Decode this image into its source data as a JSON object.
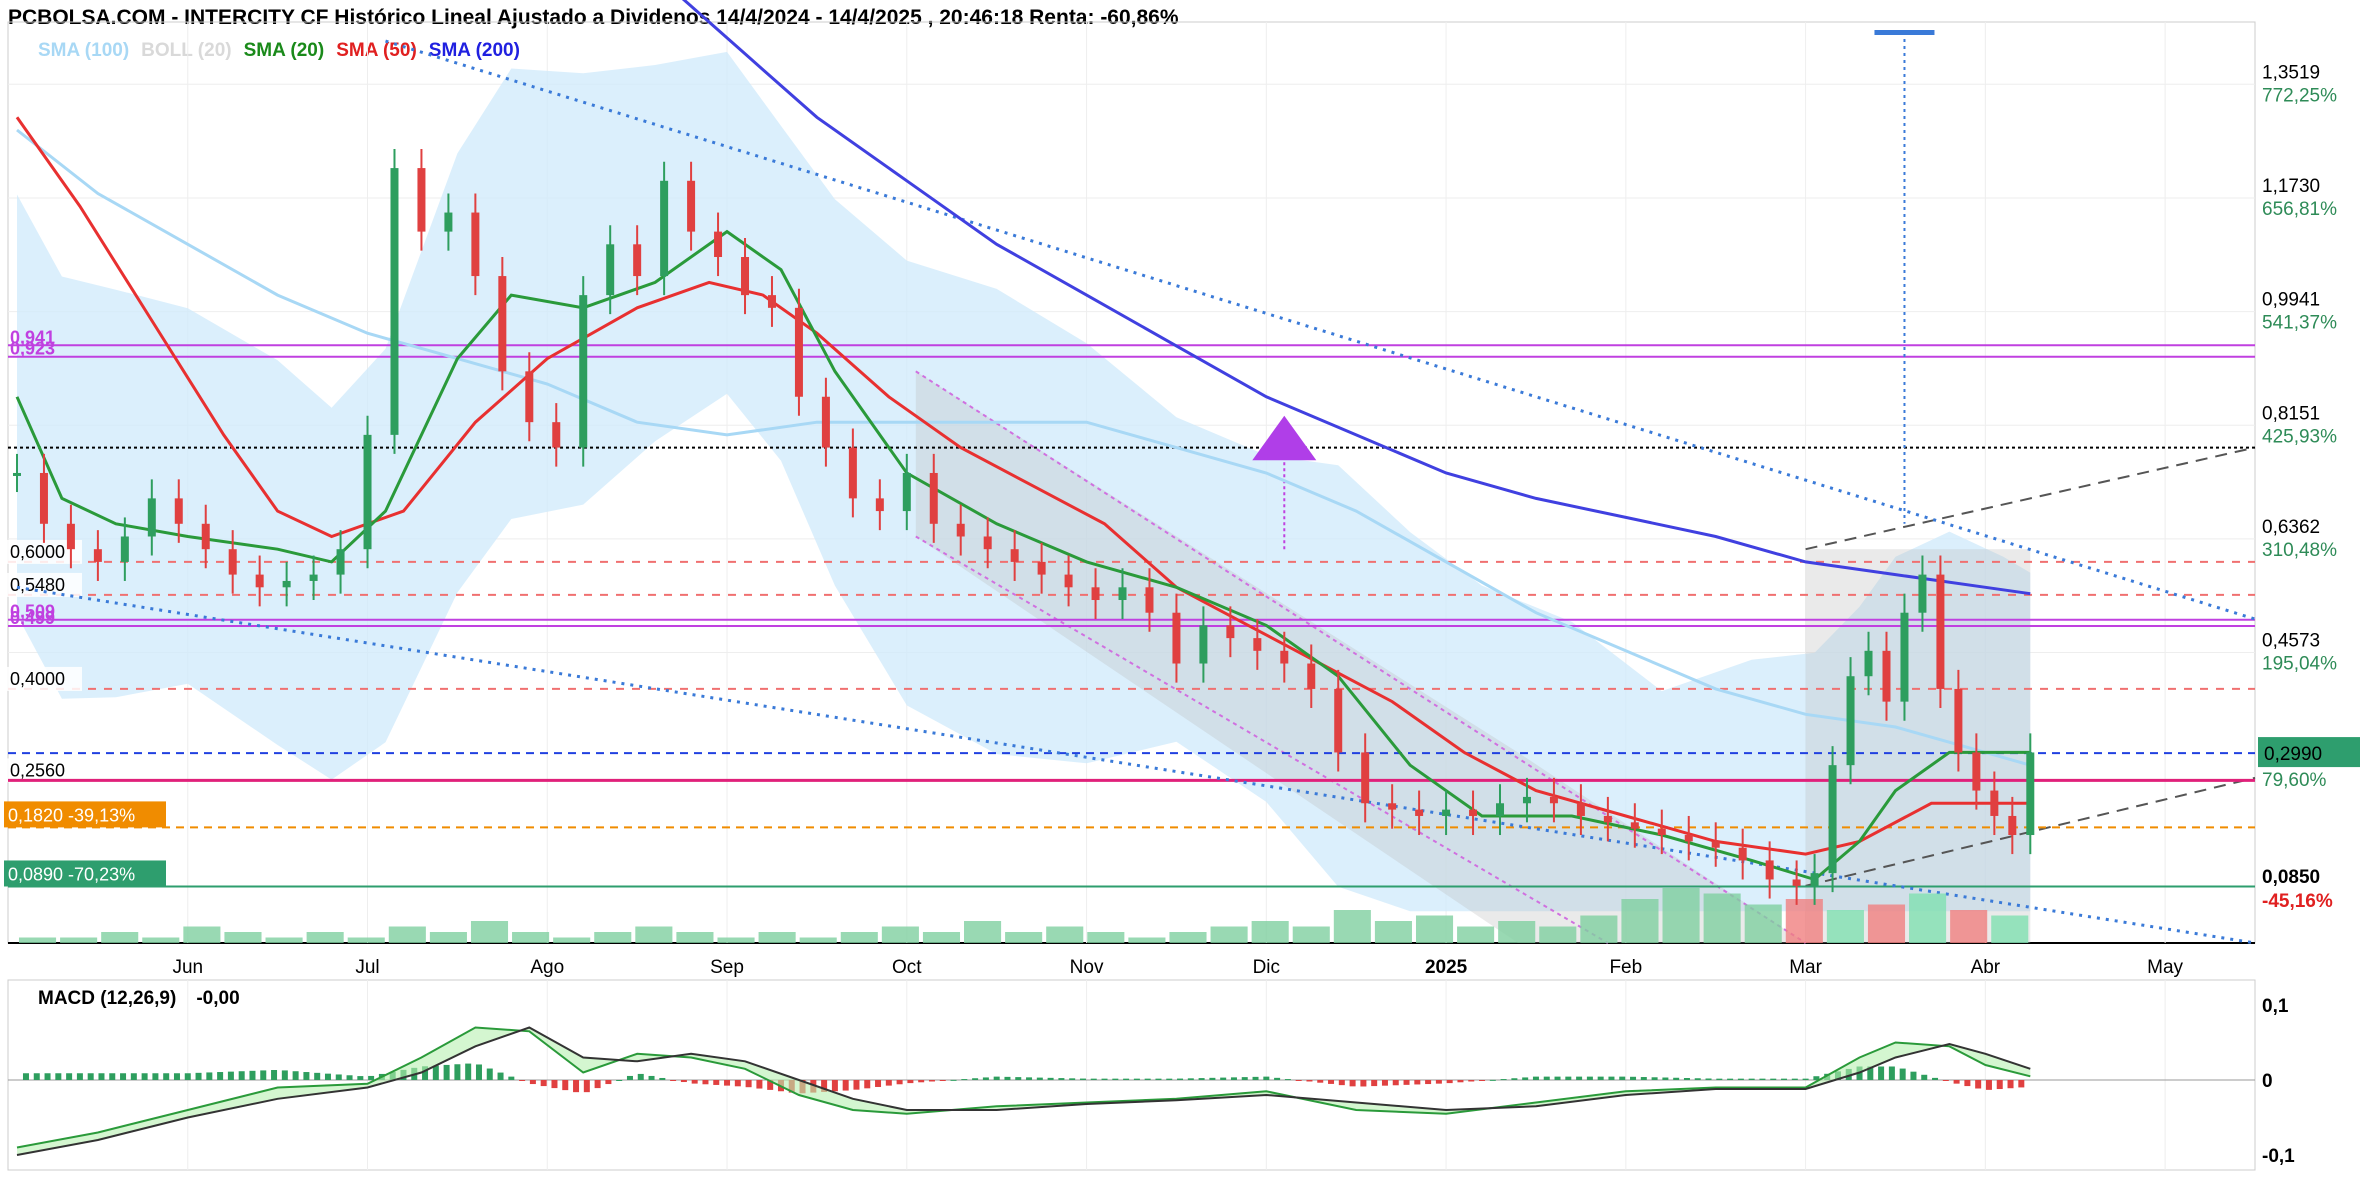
{
  "header": {
    "title": "PCBOLSA.COM - INTERCITY CF Histórico Lineal Ajustado a Dividenos 14/4/2024 - 14/4/2025 , 20:46:18 Renta: -60,86%"
  },
  "legend": [
    {
      "label": "SMA (100)",
      "color": "#a8d8f5"
    },
    {
      "label": "BOLL (20)",
      "color": "#d9d9d9"
    },
    {
      "label": "SMA (20)",
      "color": "#1a8a1a"
    },
    {
      "label": "SMA (50)",
      "color": "#e02020"
    },
    {
      "label": "SMA (200)",
      "color": "#2020e0"
    }
  ],
  "macd_panel": {
    "label": "MACD (12,26,9)",
    "value": "-0,00"
  },
  "chart_data": {
    "type": "line",
    "ylim": [
      0.0,
      1.45
    ],
    "y_ticks": [
      {
        "value": 1.3519,
        "label": "1,3519",
        "pct": "772,25%"
      },
      {
        "value": 1.173,
        "label": "1,1730",
        "pct": "656,81%"
      },
      {
        "value": 0.9941,
        "label": "0,9941",
        "pct": "541,37%"
      },
      {
        "value": 0.8151,
        "label": "0,8151",
        "pct": "425,93%"
      },
      {
        "value": 0.6362,
        "label": "0,6362",
        "pct": "310,48%"
      },
      {
        "value": 0.4573,
        "label": "0,4573",
        "pct": "195,04%"
      }
    ],
    "current_price": {
      "value": 0.299,
      "label": "0,2990",
      "pct": "79,60%",
      "color": "#2e9e6e"
    },
    "low_marker": {
      "value": 0.085,
      "label": "0,0850",
      "pct": "-45,16%"
    },
    "levels_left": [
      {
        "value": 0.6,
        "label": "0,6000"
      },
      {
        "value": 0.548,
        "label": "0,5480"
      },
      {
        "value": 0.4,
        "label": "0,4000"
      },
      {
        "value": 0.256,
        "label": "0,2560"
      }
    ],
    "levels_purple": [
      {
        "value": 0.941,
        "label": "0,941"
      },
      {
        "value": 0.923,
        "label": "0,923"
      },
      {
        "value": 0.509,
        "label": "0,509"
      },
      {
        "value": 0.499,
        "label": "0,499"
      }
    ],
    "box_orange": {
      "value": 0.182,
      "label": "0,1820",
      "pct": "-39,13%",
      "color": "#f08c00"
    },
    "box_green": {
      "value": 0.089,
      "label": "0,0890",
      "pct": "-70,23%",
      "color": "#2e9e6e"
    },
    "x_months": [
      {
        "label": "Jun",
        "t": 1.5
      },
      {
        "label": "Jul",
        "t": 2.5
      },
      {
        "label": "Ago",
        "t": 3.5
      },
      {
        "label": "Sep",
        "t": 4.5
      },
      {
        "label": "Oct",
        "t": 5.5
      },
      {
        "label": "Nov",
        "t": 6.5
      },
      {
        "label": "Dic",
        "t": 7.5
      },
      {
        "label": "2025",
        "t": 8.5
      },
      {
        "label": "Feb",
        "t": 9.5
      },
      {
        "label": "Mar",
        "t": 10.5
      },
      {
        "label": "Abr",
        "t": 11.5
      },
      {
        "label": "May",
        "t": 12.5
      }
    ],
    "xlim": [
      0.5,
      13.0
    ],
    "price": [
      [
        0.55,
        0.74
      ],
      [
        0.7,
        0.66
      ],
      [
        0.85,
        0.62
      ],
      [
        1.0,
        0.6
      ],
      [
        1.15,
        0.64
      ],
      [
        1.3,
        0.7
      ],
      [
        1.45,
        0.66
      ],
      [
        1.6,
        0.62
      ],
      [
        1.75,
        0.58
      ],
      [
        1.9,
        0.56
      ],
      [
        2.05,
        0.57
      ],
      [
        2.2,
        0.58
      ],
      [
        2.35,
        0.62
      ],
      [
        2.5,
        0.8
      ],
      [
        2.65,
        1.22
      ],
      [
        2.8,
        1.12
      ],
      [
        2.95,
        1.15
      ],
      [
        3.1,
        1.05
      ],
      [
        3.25,
        0.9
      ],
      [
        3.4,
        0.82
      ],
      [
        3.55,
        0.78
      ],
      [
        3.7,
        1.02
      ],
      [
        3.85,
        1.1
      ],
      [
        4.0,
        1.05
      ],
      [
        4.15,
        1.2
      ],
      [
        4.3,
        1.12
      ],
      [
        4.45,
        1.08
      ],
      [
        4.6,
        1.02
      ],
      [
        4.75,
        1.0
      ],
      [
        4.9,
        0.86
      ],
      [
        5.05,
        0.78
      ],
      [
        5.2,
        0.7
      ],
      [
        5.35,
        0.68
      ],
      [
        5.5,
        0.74
      ],
      [
        5.65,
        0.66
      ],
      [
        5.8,
        0.64
      ],
      [
        5.95,
        0.62
      ],
      [
        6.1,
        0.6
      ],
      [
        6.25,
        0.58
      ],
      [
        6.4,
        0.56
      ],
      [
        6.55,
        0.54
      ],
      [
        6.7,
        0.56
      ],
      [
        6.85,
        0.52
      ],
      [
        7.0,
        0.44
      ],
      [
        7.15,
        0.5
      ],
      [
        7.3,
        0.48
      ],
      [
        7.45,
        0.46
      ],
      [
        7.6,
        0.44
      ],
      [
        7.75,
        0.4
      ],
      [
        7.9,
        0.3
      ],
      [
        8.05,
        0.22
      ],
      [
        8.2,
        0.21
      ],
      [
        8.35,
        0.2
      ],
      [
        8.5,
        0.21
      ],
      [
        8.65,
        0.2
      ],
      [
        8.8,
        0.22
      ],
      [
        8.95,
        0.23
      ],
      [
        9.1,
        0.22
      ],
      [
        9.25,
        0.2
      ],
      [
        9.4,
        0.19
      ],
      [
        9.55,
        0.18
      ],
      [
        9.7,
        0.17
      ],
      [
        9.85,
        0.16
      ],
      [
        10.0,
        0.15
      ],
      [
        10.15,
        0.13
      ],
      [
        10.3,
        0.1
      ],
      [
        10.45,
        0.09
      ],
      [
        10.55,
        0.11
      ],
      [
        10.65,
        0.28
      ],
      [
        10.75,
        0.42
      ],
      [
        10.85,
        0.46
      ],
      [
        10.95,
        0.38
      ],
      [
        11.05,
        0.52
      ],
      [
        11.15,
        0.58
      ],
      [
        11.25,
        0.4
      ],
      [
        11.35,
        0.3
      ],
      [
        11.45,
        0.24
      ],
      [
        11.55,
        0.2
      ],
      [
        11.65,
        0.17
      ],
      [
        11.75,
        0.3
      ]
    ],
    "sma20": [
      [
        0.55,
        0.86
      ],
      [
        0.8,
        0.7
      ],
      [
        1.1,
        0.66
      ],
      [
        1.5,
        0.64
      ],
      [
        2.0,
        0.62
      ],
      [
        2.3,
        0.6
      ],
      [
        2.6,
        0.68
      ],
      [
        3.0,
        0.92
      ],
      [
        3.3,
        1.02
      ],
      [
        3.7,
        1.0
      ],
      [
        4.1,
        1.04
      ],
      [
        4.5,
        1.12
      ],
      [
        4.8,
        1.06
      ],
      [
        5.1,
        0.9
      ],
      [
        5.5,
        0.74
      ],
      [
        6.0,
        0.66
      ],
      [
        6.5,
        0.6
      ],
      [
        7.0,
        0.56
      ],
      [
        7.5,
        0.5
      ],
      [
        7.9,
        0.42
      ],
      [
        8.3,
        0.28
      ],
      [
        8.7,
        0.2
      ],
      [
        9.2,
        0.2
      ],
      [
        9.7,
        0.17
      ],
      [
        10.2,
        0.13
      ],
      [
        10.55,
        0.1
      ],
      [
        10.8,
        0.16
      ],
      [
        11.0,
        0.24
      ],
      [
        11.3,
        0.3
      ],
      [
        11.6,
        0.3
      ],
      [
        11.75,
        0.3
      ]
    ],
    "sma50": [
      [
        0.55,
        1.3
      ],
      [
        0.9,
        1.16
      ],
      [
        1.3,
        0.98
      ],
      [
        1.7,
        0.8
      ],
      [
        2.0,
        0.68
      ],
      [
        2.3,
        0.64
      ],
      [
        2.7,
        0.68
      ],
      [
        3.1,
        0.82
      ],
      [
        3.5,
        0.92
      ],
      [
        4.0,
        1.0
      ],
      [
        4.4,
        1.04
      ],
      [
        4.7,
        1.02
      ],
      [
        5.0,
        0.96
      ],
      [
        5.4,
        0.86
      ],
      [
        5.8,
        0.78
      ],
      [
        6.2,
        0.72
      ],
      [
        6.6,
        0.66
      ],
      [
        7.0,
        0.56
      ],
      [
        7.4,
        0.5
      ],
      [
        7.8,
        0.44
      ],
      [
        8.2,
        0.38
      ],
      [
        8.6,
        0.3
      ],
      [
        9.0,
        0.24
      ],
      [
        9.5,
        0.2
      ],
      [
        10.0,
        0.16
      ],
      [
        10.5,
        0.14
      ],
      [
        10.8,
        0.16
      ],
      [
        11.2,
        0.22
      ],
      [
        11.5,
        0.22
      ],
      [
        11.75,
        0.22
      ]
    ],
    "sma100": [
      [
        0.55,
        1.28
      ],
      [
        1.0,
        1.18
      ],
      [
        1.5,
        1.1
      ],
      [
        2.0,
        1.02
      ],
      [
        2.5,
        0.96
      ],
      [
        3.0,
        0.92
      ],
      [
        3.5,
        0.88
      ],
      [
        4.0,
        0.82
      ],
      [
        4.5,
        0.8
      ],
      [
        5.0,
        0.82
      ],
      [
        5.5,
        0.82
      ],
      [
        6.0,
        0.82
      ],
      [
        6.5,
        0.82
      ],
      [
        7.0,
        0.78
      ],
      [
        7.5,
        0.74
      ],
      [
        8.0,
        0.68
      ],
      [
        8.5,
        0.6
      ],
      [
        9.0,
        0.52
      ],
      [
        9.5,
        0.46
      ],
      [
        10.0,
        0.4
      ],
      [
        10.5,
        0.36
      ],
      [
        11.0,
        0.34
      ],
      [
        11.5,
        0.3
      ],
      [
        11.75,
        0.28
      ]
    ],
    "sma200": [
      [
        4.2,
        1.5
      ],
      [
        4.6,
        1.4
      ],
      [
        5.0,
        1.3
      ],
      [
        5.5,
        1.2
      ],
      [
        6.0,
        1.1
      ],
      [
        6.5,
        1.02
      ],
      [
        7.0,
        0.94
      ],
      [
        7.5,
        0.86
      ],
      [
        8.0,
        0.8
      ],
      [
        8.5,
        0.74
      ],
      [
        9.0,
        0.7
      ],
      [
        9.5,
        0.67
      ],
      [
        10.0,
        0.64
      ],
      [
        10.5,
        0.6
      ],
      [
        11.0,
        0.58
      ],
      [
        11.5,
        0.56
      ],
      [
        11.75,
        0.55
      ]
    ],
    "trend_upper": [
      [
        2.6,
        1.42
      ],
      [
        13.0,
        0.51
      ]
    ],
    "trend_lower": [
      [
        0.55,
        0.56
      ],
      [
        13.0,
        0.0
      ]
    ],
    "volume": [
      0.1,
      0.1,
      0.2,
      0.1,
      0.3,
      0.2,
      0.1,
      0.2,
      0.1,
      0.3,
      0.2,
      0.4,
      0.2,
      0.1,
      0.2,
      0.3,
      0.2,
      0.1,
      0.2,
      0.1,
      0.2,
      0.3,
      0.2,
      0.4,
      0.2,
      0.3,
      0.2,
      0.1,
      0.2,
      0.3,
      0.4,
      0.3,
      0.6,
      0.4,
      0.5,
      0.3,
      0.4,
      0.3,
      0.5,
      0.8,
      1.0,
      0.9,
      0.7,
      0.8,
      0.6,
      0.7,
      0.9,
      0.6,
      0.5
    ],
    "macd_ylim": [
      -0.12,
      0.12
    ],
    "macd_ticks": [
      {
        "value": 0.1,
        "label": "0,1",
        "color": "#e02020"
      },
      {
        "value": 0.0,
        "label": "0",
        "color": "#000000"
      },
      {
        "value": -0.1,
        "label": "-0,1",
        "color": "#1a8a1a"
      }
    ],
    "macd_line": [
      [
        0.55,
        -0.09
      ],
      [
        1.0,
        -0.07
      ],
      [
        1.5,
        -0.04
      ],
      [
        2.0,
        -0.01
      ],
      [
        2.5,
        -0.005
      ],
      [
        2.8,
        0.03
      ],
      [
        3.1,
        0.07
      ],
      [
        3.4,
        0.065
      ],
      [
        3.7,
        0.01
      ],
      [
        4.0,
        0.035
      ],
      [
        4.3,
        0.03
      ],
      [
        4.6,
        0.015
      ],
      [
        4.9,
        -0.02
      ],
      [
        5.2,
        -0.04
      ],
      [
        5.5,
        -0.045
      ],
      [
        6.0,
        -0.035
      ],
      [
        6.5,
        -0.03
      ],
      [
        7.0,
        -0.025
      ],
      [
        7.5,
        -0.015
      ],
      [
        8.0,
        -0.04
      ],
      [
        8.5,
        -0.045
      ],
      [
        9.0,
        -0.03
      ],
      [
        9.5,
        -0.015
      ],
      [
        10.0,
        -0.01
      ],
      [
        10.5,
        -0.01
      ],
      [
        10.8,
        0.03
      ],
      [
        11.0,
        0.05
      ],
      [
        11.3,
        0.045
      ],
      [
        11.5,
        0.02
      ],
      [
        11.75,
        0.005
      ]
    ],
    "macd_signal": [
      [
        0.55,
        -0.1
      ],
      [
        1.0,
        -0.08
      ],
      [
        1.5,
        -0.05
      ],
      [
        2.0,
        -0.025
      ],
      [
        2.5,
        -0.01
      ],
      [
        2.8,
        0.01
      ],
      [
        3.1,
        0.045
      ],
      [
        3.4,
        0.07
      ],
      [
        3.7,
        0.03
      ],
      [
        4.0,
        0.025
      ],
      [
        4.3,
        0.035
      ],
      [
        4.6,
        0.025
      ],
      [
        4.9,
        0.0
      ],
      [
        5.2,
        -0.025
      ],
      [
        5.5,
        -0.04
      ],
      [
        6.0,
        -0.04
      ],
      [
        6.5,
        -0.032
      ],
      [
        7.0,
        -0.027
      ],
      [
        7.5,
        -0.02
      ],
      [
        8.0,
        -0.03
      ],
      [
        8.5,
        -0.04
      ],
      [
        9.0,
        -0.035
      ],
      [
        9.5,
        -0.02
      ],
      [
        10.0,
        -0.012
      ],
      [
        10.5,
        -0.012
      ],
      [
        10.8,
        0.01
      ],
      [
        11.0,
        0.03
      ],
      [
        11.3,
        0.048
      ],
      [
        11.5,
        0.035
      ],
      [
        11.75,
        0.015
      ]
    ]
  }
}
